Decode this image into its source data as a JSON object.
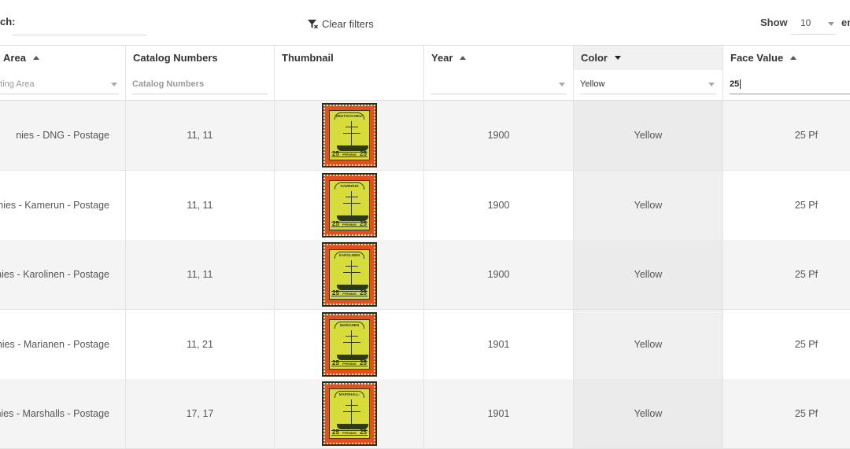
{
  "toolbar": {
    "search_label": "ch:",
    "search_value": "",
    "clear_filters_label": "Clear filters",
    "show_label": "Show",
    "show_value": "10",
    "entries_label": "en"
  },
  "columns": [
    {
      "label": "lecting Area",
      "sort": "asc"
    },
    {
      "label": "Catalog Numbers",
      "sort": "none"
    },
    {
      "label": "Thumbnail",
      "sort": "none"
    },
    {
      "label": "Year",
      "sort": "asc"
    },
    {
      "label": "Color",
      "sort": "desc"
    },
    {
      "label": "Face Value",
      "sort": "asc"
    }
  ],
  "filters": {
    "collecting_area_placeholder": "ct Collecting Area",
    "catalog_placeholder": "Catalog Numbers",
    "year_value": "",
    "color_value": "Yellow",
    "face_value_value": "25"
  },
  "rows": [
    {
      "area": "nies - DNG - Postage",
      "catalog": "11, 11",
      "stamp_banner": "DEUTSCH-NEU-GUINEA",
      "year": "1900",
      "color": "Yellow",
      "face": "25 Pf"
    },
    {
      "area": "nies - Kamerun - Postage",
      "catalog": "11, 11",
      "stamp_banner": "KAMERUN",
      "year": "1900",
      "color": "Yellow",
      "face": "25 Pf"
    },
    {
      "area": "nies - Karolinen - Postage",
      "catalog": "11, 11",
      "stamp_banner": "KAROLINEN",
      "year": "1900",
      "color": "Yellow",
      "face": "25 Pf"
    },
    {
      "area": "nies - Marianen - Postage",
      "catalog": "11, 21",
      "stamp_banner": "MARIANEN",
      "year": "1901",
      "color": "Yellow",
      "face": "25 Pf"
    },
    {
      "area": "nies - Marshalls - Postage",
      "catalog": "17, 17",
      "stamp_banner": "MARSHALL-INSELN",
      "year": "1901",
      "color": "Yellow",
      "face": "25 Pf"
    }
  ],
  "stamp": {
    "value": "25",
    "denomination": "PFENNIG"
  },
  "icons": {
    "clear_filters": "filter-clear-icon"
  },
  "colors": {
    "stamp_frame": "#e2501f",
    "stamp_center": "#d8dc3a",
    "selected_column_bg": "#f0f0f0"
  }
}
